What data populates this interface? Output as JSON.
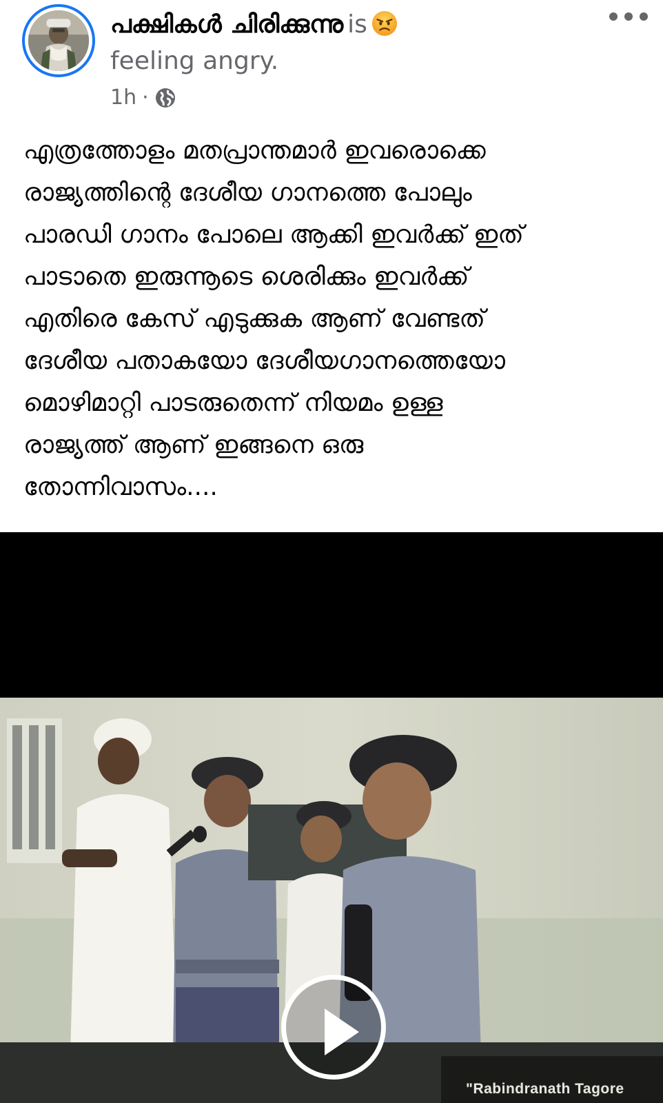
{
  "post": {
    "author": "പക്ഷികൾ ചിരിക്കുന്നു",
    "is_word": "is",
    "feeling_emoji": "angry-face-emoji",
    "feeling": "feeling angry.",
    "time": "1h",
    "separator": "·",
    "audience_icon": "globe-icon",
    "body": "എത്രത്തോളം മതപ്രാന്തമാർ ഇവരൊക്കെ\nരാജ്യത്തിന്റെ ദേശീയ ഗാനത്തെ പോലും\nപാരഡി ഗാനം പോലെ ആക്കി ഇവർക്ക് ഇത്\nപാടാതെ ഇരുന്നൂടെ ശെരിക്കും ഇവർക്ക്\nഎതിരെ കേസ് എടുക്കുക ആണ് വേണ്ടത്\nദേശീയ പതാകയോ ദേശീയഗാനത്തെയോ\nമൊഴിമാറ്റി പാടരുതെന്ന് നിയമം ഉള്ള\nരാജ്യത്ത് ആണ് ഇങ്ങനെ ഒരു\nതോന്നിവാസം...."
  },
  "video": {
    "caption": "\"Rabindranath Tagore",
    "play_icon": "play-icon"
  },
  "colors": {
    "accent": "#1877f2",
    "secondary_text": "#65676b",
    "primary_text": "#050505"
  }
}
